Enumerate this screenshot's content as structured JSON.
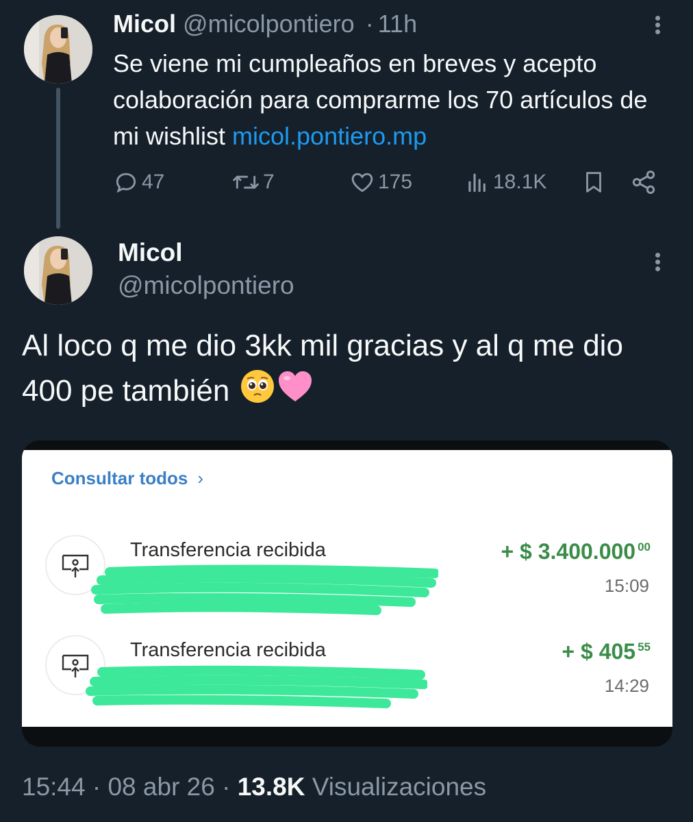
{
  "tweet1": {
    "name": "Micol",
    "handle": "@micolpontiero",
    "dot": "·",
    "time": "11h",
    "text": "Se viene mi cumpleaños en breves y acepto colaboración para comprarme los 70 artículos de mi wishlist ",
    "link": "micol.pontiero.mp",
    "replies": "47",
    "retweets": "7",
    "likes": "175",
    "views": "18.1K"
  },
  "tweet2": {
    "name": "Micol",
    "handle": "@micolpontiero",
    "text": "Al loco q me dio 3kk mil gracias y al q me dio 400 pe también",
    "emojis": [
      "pleading-face",
      "pink-heart"
    ]
  },
  "media": {
    "consultar": "Consultar todos",
    "chevron": "›",
    "transactions": [
      {
        "label": "Transferencia recibida",
        "amount": "+ $ 3.400.000",
        "cents": "00",
        "time": "15:09"
      },
      {
        "label": "Transferencia recibida",
        "amount": "+ $ 405",
        "cents": "55",
        "time": "14:29"
      }
    ],
    "accent_green": "#3a8d49",
    "redaction_color": "#3de89a"
  },
  "footer": {
    "time": "15:44",
    "date": "08 abr 26",
    "sep": "·",
    "views_count": "13.8K",
    "views_label": "Visualizaciones"
  }
}
